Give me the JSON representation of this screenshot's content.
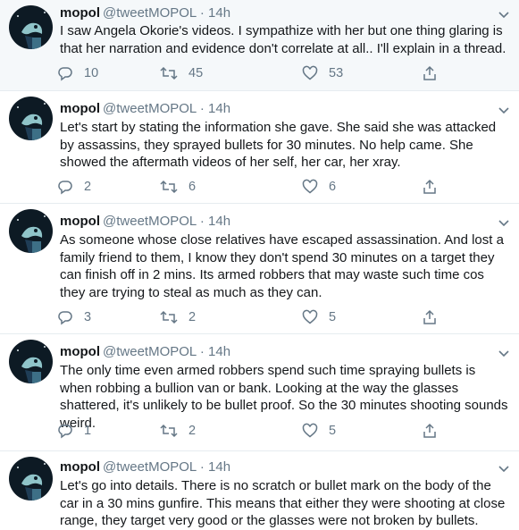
{
  "tweets": [
    {
      "name": "mopol",
      "handle": "@tweetMOPOL",
      "time": "14h",
      "text": "I saw Angela Okorie's videos. I sympathize with her but one thing glaring is that her narration and evidence don't correlate at all.. I'll explain in a thread.",
      "replies": "10",
      "retweets": "45",
      "likes": "53"
    },
    {
      "name": "mopol",
      "handle": "@tweetMOPOL",
      "time": "14h",
      "text": "Let's start by stating the information she gave. She said she was attacked by assassins, they sprayed bullets for 30 minutes. No help came. She showed the aftermath videos of her self, her car, her xray.",
      "replies": "2",
      "retweets": "6",
      "likes": "6"
    },
    {
      "name": "mopol",
      "handle": "@tweetMOPOL",
      "time": "14h",
      "text": "As someone whose close relatives have escaped assassination. And lost a family friend to them, I know they don't spend 30 minutes on a target they can finish off in 2 mins. Its armed robbers that may waste such time cos they are trying to steal as much as they can.",
      "replies": "3",
      "retweets": "2",
      "likes": "5"
    },
    {
      "name": "mopol",
      "handle": "@tweetMOPOL",
      "time": "14h",
      "text": "The only time even armed robbers spend such time spraying bullets is when robbing a bullion van or bank. Looking at the way the glasses shattered, it's unlikely to be bullet proof. So the 30 minutes shooting sounds weird.",
      "replies": "1",
      "retweets": "2",
      "likes": "5"
    },
    {
      "name": "mopol",
      "handle": "@tweetMOPOL",
      "time": "14h",
      "text": "Let's go into details. There is no scratch or bullet mark on the body of the car in a 30 mins gunfire. This means that either they were shooting at close range, they target very good or the glasses were not broken by bullets."
    }
  ],
  "dot_separator": "·",
  "colors": {
    "secondary": "#657786",
    "border": "#e6ecf0",
    "first_bg": "#f5f8fa"
  }
}
